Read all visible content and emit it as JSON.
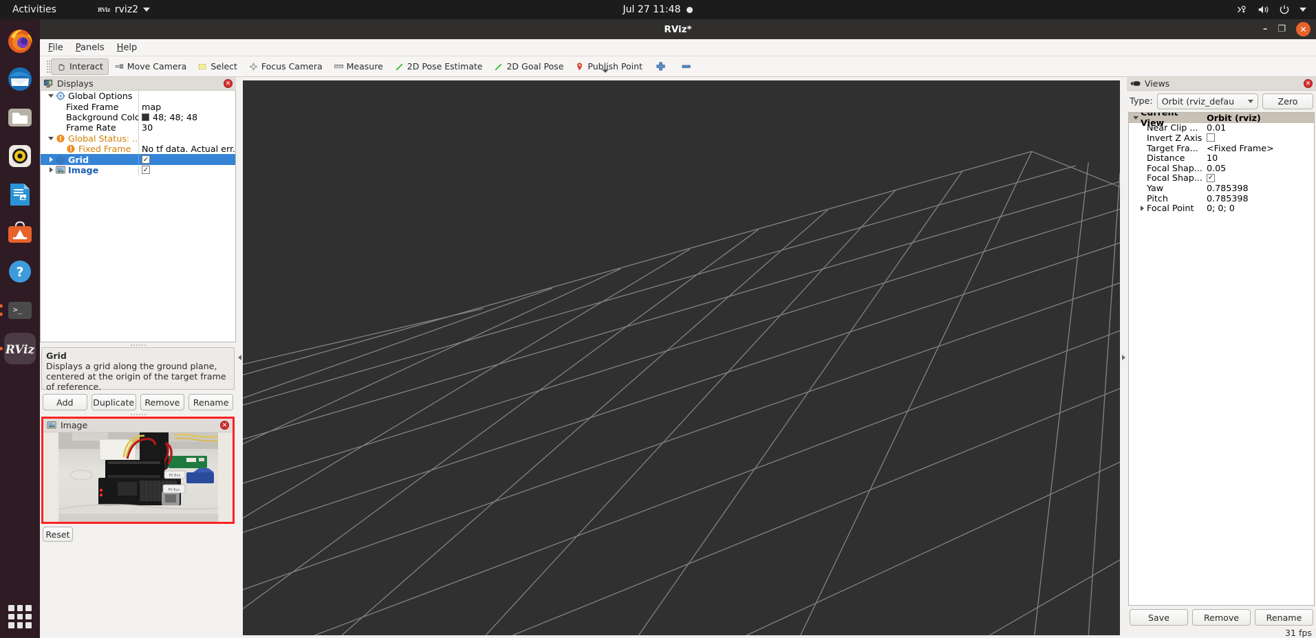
{
  "topbar": {
    "activities": "Activities",
    "app_name": "rviz2",
    "app_icon": "rviz-icon",
    "clock": "Jul 27  11:48",
    "recording_icon": "recording-dot-icon",
    "tray_icons": [
      "network-icon",
      "volume-icon",
      "power-icon",
      "chevron-down-icon"
    ]
  },
  "dock": {
    "items": [
      {
        "name": "firefox",
        "running": false
      },
      {
        "name": "thunderbird",
        "running": false
      },
      {
        "name": "files",
        "running": false
      },
      {
        "name": "rhythmbox",
        "running": false
      },
      {
        "name": "libreoffice-writer",
        "running": false
      },
      {
        "name": "ubuntu-software",
        "running": false
      },
      {
        "name": "help",
        "running": false
      },
      {
        "name": "terminal",
        "running": true
      },
      {
        "name": "rviz",
        "running": true
      }
    ],
    "show_apps_label": "Show Applications"
  },
  "window": {
    "title": "RViz*",
    "minimize_label": "–",
    "maximize_label": "❐",
    "close_label": "✕"
  },
  "menubar": [
    {
      "label": "File",
      "accel": "F"
    },
    {
      "label": "Panels",
      "accel": "P"
    },
    {
      "label": "Help",
      "accel": "H"
    }
  ],
  "toolbar": {
    "buttons": [
      {
        "label": "Interact",
        "icon": "hand-cursor-icon",
        "pressed": true
      },
      {
        "label": "Move Camera",
        "icon": "move-camera-icon",
        "pressed": false
      },
      {
        "label": "Select",
        "icon": "select-rect-icon",
        "pressed": false
      },
      {
        "label": "Focus Camera",
        "icon": "focus-camera-icon",
        "pressed": false
      },
      {
        "label": "Measure",
        "icon": "measure-ruler-icon",
        "pressed": false
      },
      {
        "label": "2D Pose Estimate",
        "icon": "green-arrow-icon",
        "pressed": false
      },
      {
        "label": "2D Goal Pose",
        "icon": "green-arrow-icon",
        "pressed": false
      },
      {
        "label": "Publish Point",
        "icon": "red-pin-icon",
        "pressed": false
      },
      {
        "label": "",
        "icon": "plus-icon",
        "pressed": false
      },
      {
        "label": "",
        "icon": "minus-icon",
        "pressed": false
      }
    ],
    "overflow_icon": "chevron-down-icon"
  },
  "displays_panel": {
    "title": "Displays",
    "title_icon": "displays-monitor-icon",
    "close_icon": "close-icon",
    "tree": [
      {
        "label": "Global Options",
        "value": "",
        "icon": "gear-icon",
        "arrow": "down",
        "indent": 0,
        "style": "normal",
        "value_type": "none"
      },
      {
        "label": "Fixed Frame",
        "value": "map",
        "icon": "none",
        "arrow": "none",
        "indent": 1,
        "style": "normal",
        "value_type": "text"
      },
      {
        "label": "Background Color",
        "value": "48; 48; 48",
        "icon": "none",
        "arrow": "none",
        "indent": 1,
        "style": "normal",
        "value_type": "color"
      },
      {
        "label": "Frame Rate",
        "value": "30",
        "icon": "none",
        "arrow": "none",
        "indent": 1,
        "style": "normal",
        "value_type": "text"
      },
      {
        "label": "Global Status: ...",
        "value": "",
        "icon": "warning-icon",
        "arrow": "down",
        "indent": 0,
        "style": "warn",
        "value_type": "none"
      },
      {
        "label": "Fixed Frame",
        "value": "No tf data.  Actual err...",
        "icon": "warning-icon",
        "arrow": "none",
        "indent": 1,
        "style": "warn",
        "value_type": "text"
      },
      {
        "label": "Grid",
        "value": "",
        "icon": "grid-icon",
        "arrow": "right",
        "indent": 0,
        "style": "selected",
        "value_type": "checkbox"
      },
      {
        "label": "Image",
        "value": "",
        "icon": "image-icon",
        "arrow": "right",
        "indent": 0,
        "style": "blue",
        "value_type": "checkbox"
      }
    ],
    "help": {
      "title": "Grid",
      "text": "Displays a grid along the ground plane, centered at the origin of the target frame of reference."
    },
    "buttons": [
      "Add",
      "Duplicate",
      "Remove",
      "Rename"
    ]
  },
  "image_panel": {
    "title": "Image",
    "title_icon": "image-icon",
    "close_icon": "close-icon",
    "content": "camera-photo-electronics-board"
  },
  "reset_button": "Reset",
  "views_panel": {
    "title": "Views",
    "title_icon": "views-camera-icon",
    "close_icon": "close-icon",
    "type_label": "Type:",
    "type_value": "Orbit (rviz_defau",
    "zero_button": "Zero",
    "columns": [
      "Current View",
      "Orbit (rviz)"
    ],
    "rows": [
      {
        "label": "Near Clip ...",
        "value": "0.01",
        "type": "text",
        "arrow": "none"
      },
      {
        "label": "Invert Z Axis",
        "value": "",
        "type": "checkbox-off",
        "arrow": "none"
      },
      {
        "label": "Target Fra...",
        "value": "<Fixed Frame>",
        "type": "text",
        "arrow": "none"
      },
      {
        "label": "Distance",
        "value": "10",
        "type": "text",
        "arrow": "none"
      },
      {
        "label": "Focal Shap...",
        "value": "0.05",
        "type": "text",
        "arrow": "none"
      },
      {
        "label": "Focal Shap...",
        "value": "",
        "type": "checkbox-on",
        "arrow": "none"
      },
      {
        "label": "Yaw",
        "value": "0.785398",
        "type": "text",
        "arrow": "none"
      },
      {
        "label": "Pitch",
        "value": "0.785398",
        "type": "text",
        "arrow": "none"
      },
      {
        "label": "Focal Point",
        "value": "0; 0; 0",
        "type": "text",
        "arrow": "right"
      }
    ],
    "buttons": [
      "Save",
      "Remove",
      "Rename"
    ],
    "fps": "31 fps"
  },
  "viewport": {
    "background_color": "#303030",
    "grid_color": "#9a9a9a",
    "left_collapse_icon": "collapse-left-icon",
    "right_collapse_icon": "collapse-right-icon"
  }
}
